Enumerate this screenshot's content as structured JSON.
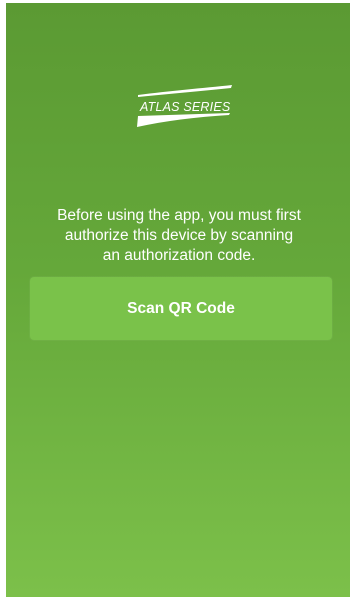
{
  "logo": {
    "icon": "atlas-series-logo",
    "text": "ATLAS SERIES"
  },
  "auth": {
    "message_lines": [
      "Before using the app, you must first",
      "authorize this device by scanning",
      "an authorization code."
    ],
    "scan_button_label": "Scan QR Code"
  },
  "colors": {
    "background_top": "#5b9a33",
    "background_bottom": "#7cc04a",
    "button": "#7ac24a",
    "text": "#ffffff"
  }
}
